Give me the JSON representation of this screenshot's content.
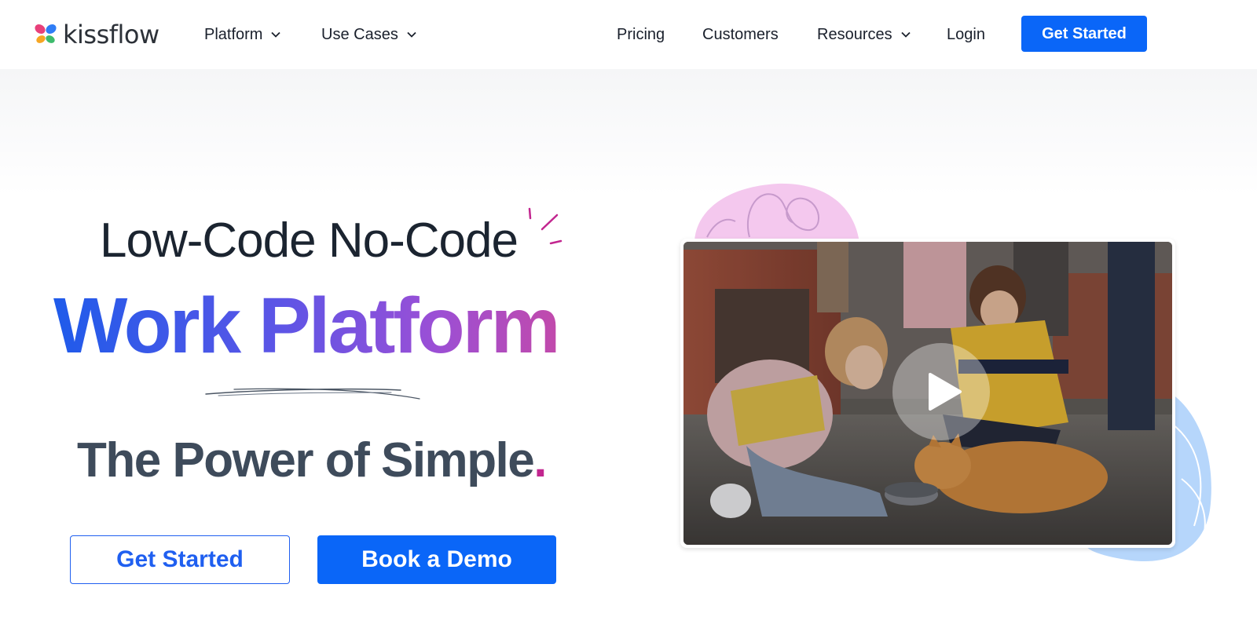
{
  "brand": {
    "name": "kissflow"
  },
  "nav": {
    "left": [
      {
        "label": "Platform",
        "has_dropdown": true
      },
      {
        "label": "Use Cases",
        "has_dropdown": true
      }
    ],
    "right": [
      {
        "label": "Pricing",
        "has_dropdown": false
      },
      {
        "label": "Customers",
        "has_dropdown": false
      },
      {
        "label": "Resources",
        "has_dropdown": true
      },
      {
        "label": "Login",
        "has_dropdown": false
      }
    ],
    "cta": "Get Started"
  },
  "hero": {
    "line1": "Low-Code No-Code",
    "line2": "Work Platform",
    "line3": "The Power of Simple",
    "line3_punct": ".",
    "primary_cta": "Get Started",
    "secondary_cta": "Book a Demo"
  },
  "video": {
    "play_icon": "play-icon"
  },
  "colors": {
    "accent_blue": "#0a66f8",
    "gradient_start": "#1f5bea",
    "gradient_end": "#c24aab",
    "dot_magenta": "#c2268f",
    "tagline_gray": "#3e4b5b",
    "blob_pink": "#f4c8ee",
    "blob_blue": "#b6d6fb"
  }
}
